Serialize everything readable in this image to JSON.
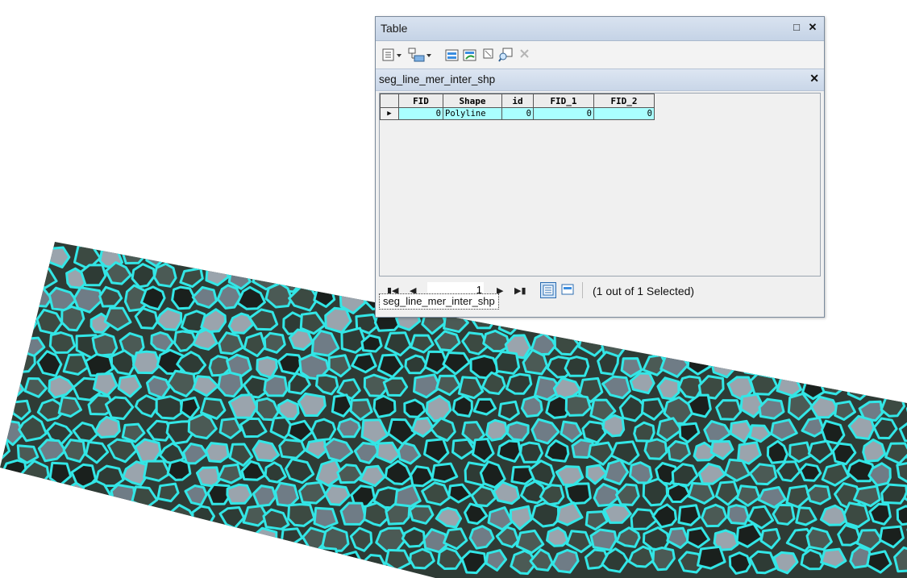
{
  "window": {
    "title": "Table",
    "restore_icon": "restore-window-icon",
    "close_icon": "close-icon"
  },
  "toolbar": {
    "icons": [
      "table-options-icon",
      "related-tables-icon",
      "select-by-attributes-icon",
      "switch-selection-icon",
      "clear-selection-icon",
      "zoom-to-selected-icon",
      "delete-selected-icon"
    ]
  },
  "tab": {
    "title": "seg_line_mer_inter_shp"
  },
  "table": {
    "columns": [
      "FID",
      "Shape",
      "id",
      "FID_1",
      "FID_2"
    ],
    "rows": [
      [
        "0",
        "Polyline",
        "0",
        "0",
        "0"
      ]
    ]
  },
  "nav": {
    "current_record": "1",
    "selection_status": "(1 out of 1 Selected)"
  },
  "bottom_tab": {
    "label": "seg_line_mer_inter_shp"
  },
  "map": {
    "line_color": "#33e6e6",
    "imagery_colors": [
      "#2e3b35",
      "#4b5a55",
      "#6f7c86",
      "#1a201d",
      "#9aa4ad",
      "#3c4a42"
    ]
  }
}
